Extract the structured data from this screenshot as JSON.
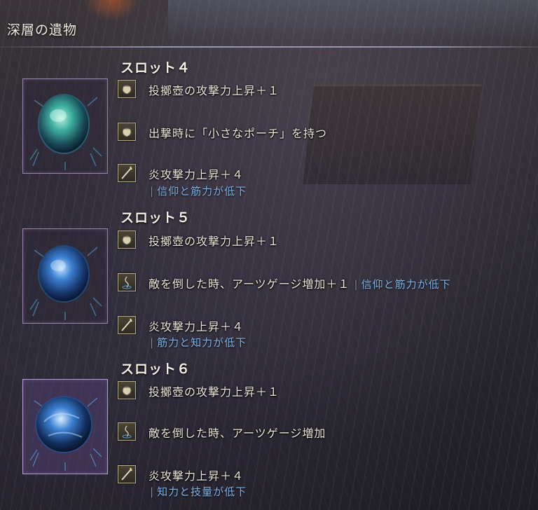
{
  "header": {
    "title": "深層の遺物"
  },
  "slots": [
    {
      "title": "スロット４",
      "relic_color": "green",
      "effects": [
        {
          "icon": "pouch-icon",
          "text": "投擲壺の攻撃力上昇＋１",
          "penalty": ""
        },
        {
          "icon": "pouch-icon",
          "text": "出撃時に「小さなポーチ」を持つ",
          "penalty": ""
        },
        {
          "icon": "sword-icon",
          "text": "炎攻撃力上昇＋４",
          "penalty": "信仰と筋力が低下"
        }
      ]
    },
    {
      "title": "スロット５",
      "relic_color": "blue",
      "effects": [
        {
          "icon": "pouch-icon",
          "text": "投擲壺の攻撃力上昇＋１",
          "penalty": ""
        },
        {
          "icon": "art-gauge-icon",
          "text": "敵を倒した時、アーツゲージ増加＋１",
          "penalty": "信仰と筋力が低下"
        },
        {
          "icon": "sword-icon",
          "text": "炎攻撃力上昇＋４",
          "penalty": "筋力と知力が低下"
        }
      ]
    },
    {
      "title": "スロット６",
      "relic_color": "blue",
      "effects": [
        {
          "icon": "pouch-icon",
          "text": "投擲壺の攻撃力上昇＋１",
          "penalty": ""
        },
        {
          "icon": "art-gauge-icon",
          "text": "敵を倒した時、アーツゲージ増加",
          "penalty": ""
        },
        {
          "icon": "sword-icon",
          "text": "炎攻撃力上昇＋４",
          "penalty": "知力と技量が低下"
        }
      ]
    }
  ],
  "colors": {
    "penalty": "#7fb4e8",
    "relic_green": "#3fb0a0",
    "relic_blue": "#3a7fd0"
  }
}
